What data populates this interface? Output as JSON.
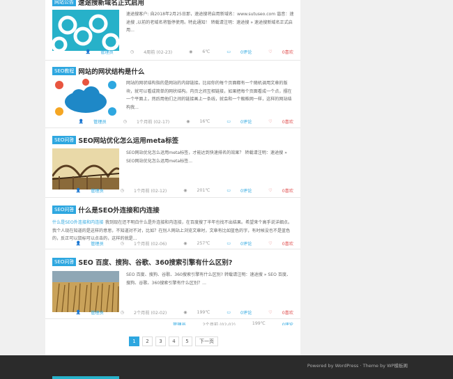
{
  "posts": [
    {
      "tag": "网站公告",
      "title": "速途搜新域名正式启用",
      "excerpt": "速途搜客户: 自2018年2月25日那，速途搜将启用新域名：www.sutuseo.com 谐音：速途搜 ,以前的老域名将暂停使用。特此通知！ 转载请注明：速途搜 » 速途搜新域名正式启用...",
      "author": "管理员",
      "time": "4周前 (02-23)",
      "views": "6℃",
      "comments": "0评论",
      "likes": "0喜欢"
    },
    {
      "tag": "SEO教程",
      "title": "网站的网状结构是什么",
      "excerpt": "网站的网状结构指的是网站的内部链接。比如你的每个页面都有一个随机调用文章的版块，就可以看成简单的网状结构。内页之间互相链接，如果把每个页面看成一个点，摆在一个平面上，然后用他们之间的链接画上一条线，就会和一个蜘蛛网一样，这样的网站结构我...",
      "author": "管理员",
      "time": "1个月前 (02-17)",
      "views": "16℃",
      "comments": "0评论",
      "likes": "0喜欢"
    },
    {
      "tag": "SEO问答",
      "title": "SEO网站优化怎么运用meta标签",
      "excerpt": "SEO网站优化怎么运用meta标签，才能达到快速排名的效果？ 转载请注明：速途搜 » SEO网站优化怎么运用meta标签...",
      "author": "管理员",
      "time": "1个月前 (02-12)",
      "views": "201℃",
      "comments": "0评论",
      "likes": "0喜欢"
    },
    {
      "tag": "SEO问答",
      "title": "什么是SEO外连接和内连接",
      "link": "什么是SEO外连接和内连接",
      "excerpt": "我到现在还不明白什么是外连接和内连接，在百度搜了半年也找不出结果。希望来个高手说详细点。我个人现在知道的是这样的意思，不知道对不对，比如？在别人网站上浏览文章时，文章有比如蓝色的字，有时候没也不是蓝色的，反正可以鼠标可以点击的，这样的就是...",
      "author": "管理员",
      "time": "1个月前 (02-06)",
      "views": "257℃",
      "comments": "0评论",
      "likes": "0喜欢"
    },
    {
      "tag": "SEO问答",
      "title": "SEO 百度、搜狗、谷歌、360搜索引擎有什么区别?",
      "excerpt": "SEO 百度、搜狗、谷歌、360搜索引擎有什么区别? 转载请注明：速途搜 » SEO 百度、搜狗、谷歌、360搜索引擎有什么区别？...",
      "author": "管理员",
      "time": "2个月前 (02-02)",
      "views": "199℃",
      "comments": "0评论",
      "likes": "0喜欢"
    }
  ],
  "pagination": {
    "pages": [
      "1",
      "2",
      "3",
      "4",
      "5"
    ],
    "next": "下一页",
    "active": "1"
  },
  "footer": {
    "text": "Powered by WordPress · Theme by WP模板阁"
  },
  "colors": {
    "accent": "#2ea7e0",
    "like": "#e05050",
    "footer_bg": "#2b2b2b"
  }
}
